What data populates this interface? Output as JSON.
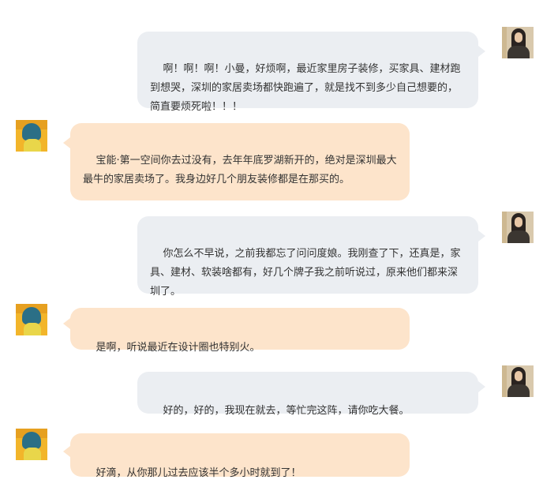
{
  "chat": {
    "messages": [
      {
        "sender": "me",
        "text": "啊！啊！啊！小曼，好烦啊，最近家里房子装修，买家具、建材跑到想哭，深圳的家居卖场都快跑遍了，就是找不到多少自己想要的，简直要烦死啦！！！"
      },
      {
        "sender": "friend",
        "text": "宝能·第一空间你去过没有，去年年底罗湖新开的，绝对是深圳最大最牛的家居卖场了。我身边好几个朋友装修都是在那买的。"
      },
      {
        "sender": "me",
        "text": "你怎么不早说，之前我都忘了问问度娘。我刚查了下，还真是，家具、建材、软装啥都有，好几个牌子我之前听说过，原来他们都来深圳了。"
      },
      {
        "sender": "friend",
        "text": "是啊，听说最近在设计圈也特别火。"
      },
      {
        "sender": "me",
        "text": "好的，好的，我现在就去，等忙完这阵，请你吃大餐。"
      },
      {
        "sender": "friend",
        "text": "好滴，从你那儿过去应该半个多小时就到了！"
      }
    ]
  }
}
